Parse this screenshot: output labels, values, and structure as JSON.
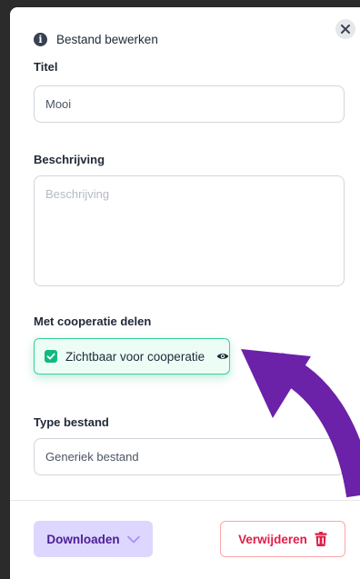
{
  "header": {
    "title": "Bestand bewerken",
    "info_icon": "info-icon",
    "close_icon": "close-icon"
  },
  "fields": {
    "title": {
      "label": "Titel",
      "value": "Mooi"
    },
    "description": {
      "label": "Beschrijving",
      "placeholder": "Beschrijving",
      "value": ""
    },
    "share": {
      "label": "Met cooperatie delen",
      "checkbox_label": "Zichtbaar voor cooperatie",
      "checked": true,
      "eye_icon": "eye-icon"
    },
    "type": {
      "label": "Type bestand",
      "value": "Generiek bestand"
    }
  },
  "footer": {
    "download_label": "Downloaden",
    "delete_label": "Verwijderen"
  },
  "colors": {
    "accent_green": "#10b981",
    "download_bg": "#ddd6fe",
    "delete_red": "#e11d48",
    "arrow_purple": "#6b21a8"
  }
}
